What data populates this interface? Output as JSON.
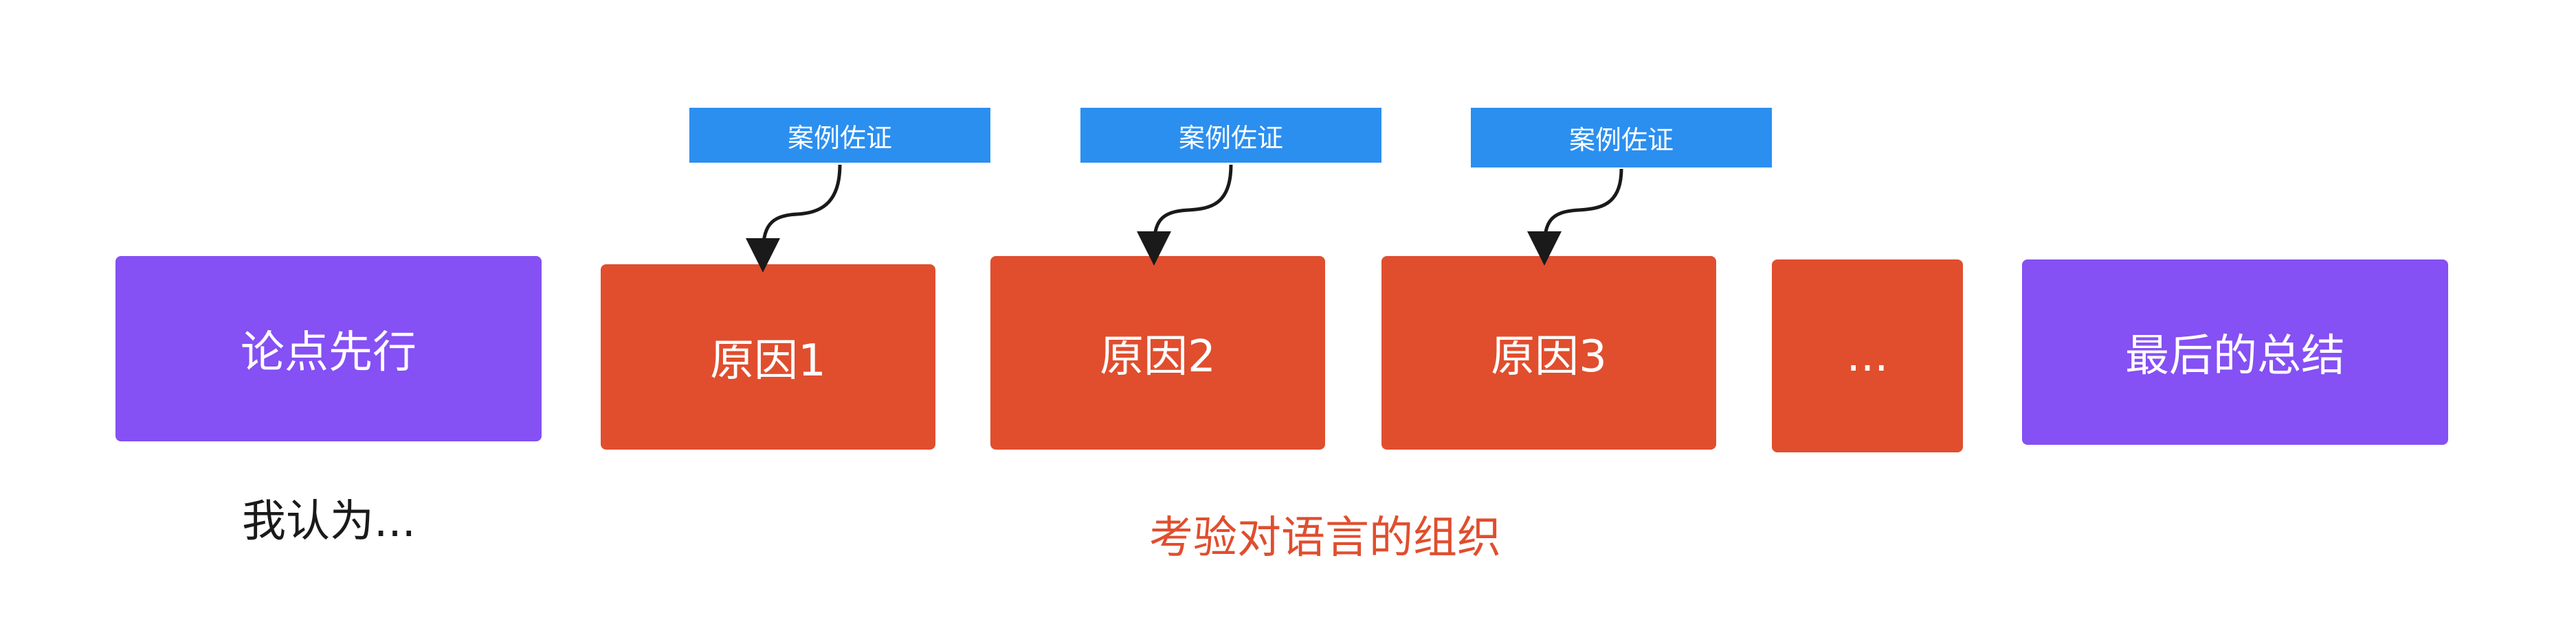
{
  "colors": {
    "purple": "#8550F4",
    "red": "#E04E2E",
    "blue": "#2B8FF0",
    "caption_dark": "#1a1a1a",
    "caption_red": "#E04E2E"
  },
  "boxes": {
    "opening": "论点先行",
    "reason1": "原因1",
    "reason2": "原因2",
    "reason3": "原因3",
    "more": "...",
    "summary": "最后的总结"
  },
  "tags": {
    "tag1": "案例佐证",
    "tag2": "案例佐证",
    "tag3": "案例佐证"
  },
  "captions": {
    "left": "我认为...",
    "middle": "考验对语言的组织"
  }
}
